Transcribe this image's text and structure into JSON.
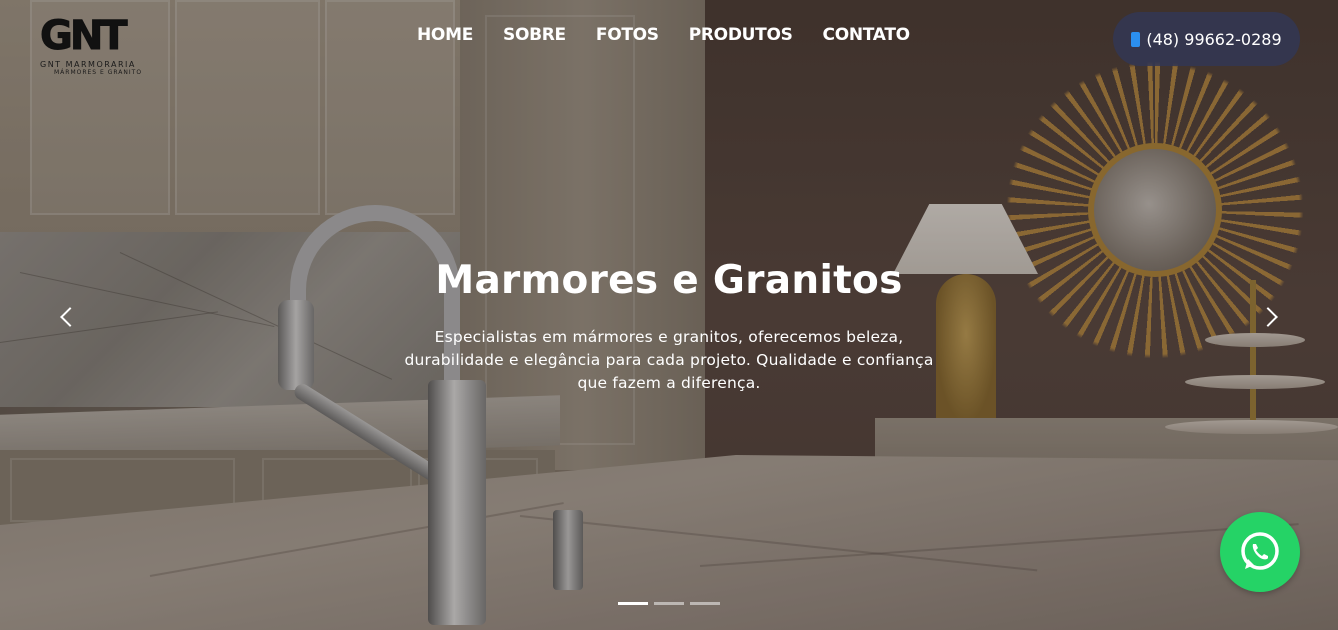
{
  "logo": {
    "mark": "GNT",
    "line1": "GNT MARMORARIA",
    "line2": "MÁRMORES E GRANITO",
    "icon": "gnt-logo"
  },
  "nav": {
    "items": [
      {
        "label": "HOME"
      },
      {
        "label": "SOBRE"
      },
      {
        "label": "FOTOS"
      },
      {
        "label": "PRODUTOS"
      },
      {
        "label": "CONTATO"
      }
    ]
  },
  "phone": {
    "number": "(48) 99662-0289",
    "icon": "mobile-phone-icon",
    "accent": "#2b8ff0",
    "background": "#323755"
  },
  "hero": {
    "title": "Marmores e Granitos",
    "description": "Especialistas em mármores e granitos, oferecemos beleza, durabilidade e elegância para cada projeto. Qualidade e confiança que fazem a diferença."
  },
  "carousel": {
    "prev_icon": "chevron-left-icon",
    "next_icon": "chevron-right-icon",
    "slides": 3,
    "active_index": 0
  },
  "whatsapp": {
    "icon": "whatsapp-icon",
    "color": "#25d366"
  }
}
